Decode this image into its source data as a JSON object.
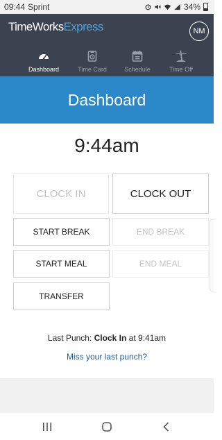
{
  "status_bar": {
    "time": "09:44",
    "carrier": "Sprint",
    "battery": "34%"
  },
  "header": {
    "logo_primary": "TimeWorks",
    "logo_accent": "Express",
    "user_initials": "NM"
  },
  "nav": {
    "dashboard": "Dashboard",
    "time_card": "Time Card",
    "schedule": "Schedule",
    "time_off": "Time Off"
  },
  "page_title": "Dashboard",
  "current_time": "9:44am",
  "actions": {
    "clock_in": "CLOCK IN",
    "clock_out": "CLOCK OUT",
    "start_break": "START BREAK",
    "end_break": "END BREAK",
    "start_meal": "START MEAL",
    "end_meal": "END MEAL",
    "transfer": "TRANSFER"
  },
  "last_punch": {
    "label": "Last Punch:",
    "type": "Clock In",
    "at": "at",
    "time": "9:41am"
  },
  "missed_punch_link": "Miss your last punch?",
  "colors": {
    "header_bg": "#3b4350",
    "title_bar_bg": "#2a87c8",
    "link": "#1f5fa0",
    "disabled_text": "#c3c3c3"
  },
  "icons": [
    "alarm-icon",
    "mute-icon",
    "wifi-icon",
    "signal-icon",
    "battery-icon",
    "dashboard-gauge-icon",
    "time-card-icon",
    "calendar-icon",
    "palm-tree-icon",
    "recents-icon",
    "home-icon",
    "back-icon"
  ]
}
